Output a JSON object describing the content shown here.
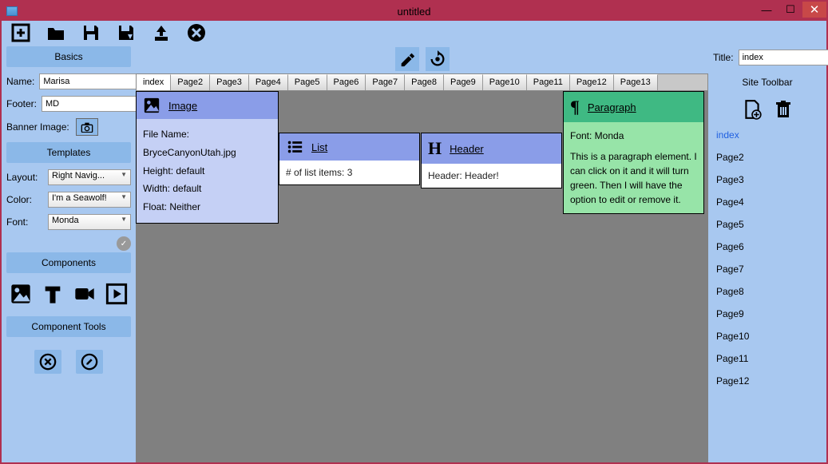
{
  "window": {
    "title": "untitled"
  },
  "basics": {
    "header": "Basics",
    "name_label": "Name:",
    "name_value": "Marisa",
    "footer_label": "Footer:",
    "footer_value": "MD",
    "banner_label": "Banner Image:"
  },
  "templates": {
    "header": "Templates",
    "layout_label": "Layout:",
    "layout_value": "Right Navig...",
    "color_label": "Color:",
    "color_value": "I'm a Seawolf!",
    "font_label": "Font:",
    "font_value": "Monda"
  },
  "components_header": "Components",
  "component_tools_header": "Component Tools",
  "tabs": [
    "index",
    "Page2",
    "Page3",
    "Page4",
    "Page5",
    "Page6",
    "Page7",
    "Page8",
    "Page9",
    "Page10",
    "Page11",
    "Page12",
    "Page13"
  ],
  "active_tab": "index",
  "canvas": {
    "image": {
      "title": "Image",
      "filename_label": "File Name: BryceCanyonUtah.jpg",
      "height_label": "Height: default",
      "width_label": "Width: default",
      "float_label": "Float: Neither"
    },
    "list": {
      "title": "List",
      "count_label": "# of list items: 3"
    },
    "headercomp": {
      "title": "Header",
      "text_label": "Header: Header!"
    },
    "paragraph": {
      "title": "Paragraph",
      "font_label": "Font: Monda",
      "body": "This is a paragraph element. I can click on it and it will turn green. Then I will have the option to edit or remove it."
    }
  },
  "right": {
    "title_label": "Title:",
    "title_value": "index",
    "site_toolbar": "Site Toolbar",
    "pages": [
      "index",
      "Page2",
      "Page3",
      "Page4",
      "Page5",
      "Page6",
      "Page7",
      "Page8",
      "Page9",
      "Page10",
      "Page11",
      "Page12"
    ],
    "active_page": "index"
  }
}
